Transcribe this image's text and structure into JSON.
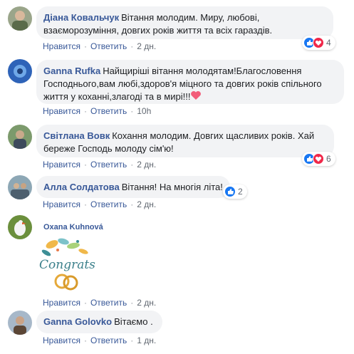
{
  "comments": [
    {
      "author": "Діана Ковальчук",
      "text_lines": [
        "Вітання молодим. Миру, любові,",
        "взаєморозуміння, довгих років життя та всіх гараздів."
      ],
      "like_label": "Нравится",
      "reply_label": "Ответить",
      "time": "2 дн.",
      "reactions_count": "4"
    },
    {
      "author": "Ganna Rufka",
      "text_lines": [
        "Найщиріші вітання молодятам!Благословення",
        "Господнього,вам любі,здоров'я міцного та довгих років спільного",
        "життя у коханні,злагоді та в мирі!!!"
      ],
      "like_label": "Нравится",
      "reply_label": "Ответить",
      "time": "10h"
    },
    {
      "author": "Світлана Вовк",
      "text_lines": [
        "Кохання молодим. Довгих щасливих років. Хай",
        "береже Господь молоду сім'ю!"
      ],
      "like_label": "Нравится",
      "reply_label": "Ответить",
      "time": "2 дн.",
      "reactions_count": "6"
    },
    {
      "author": "Алла Солдатова",
      "text_lines": [
        "Вітання! На многія літа!"
      ],
      "like_label": "Нравится",
      "reply_label": "Ответить",
      "time": "2 дн.",
      "reactions_count": "2"
    },
    {
      "author": "Oxana Kuhnová",
      "sticker_text": "Congrats",
      "like_label": "Нравится",
      "reply_label": "Ответить",
      "time": "2 дн."
    },
    {
      "author": "Ganna Golovko",
      "text_lines": [
        "Вітаємо ."
      ],
      "like_label": "Нравится",
      "reply_label": "Ответить",
      "time": "1 дн."
    }
  ],
  "colors": {
    "author": "#385898",
    "bubble": "#f2f3f5",
    "like_reaction": "#1877f2",
    "love_reaction": "#f0284a",
    "meta": "#606770"
  },
  "icons": [
    "like-reaction-icon",
    "love-reaction-icon",
    "heart-emoji-icon"
  ]
}
